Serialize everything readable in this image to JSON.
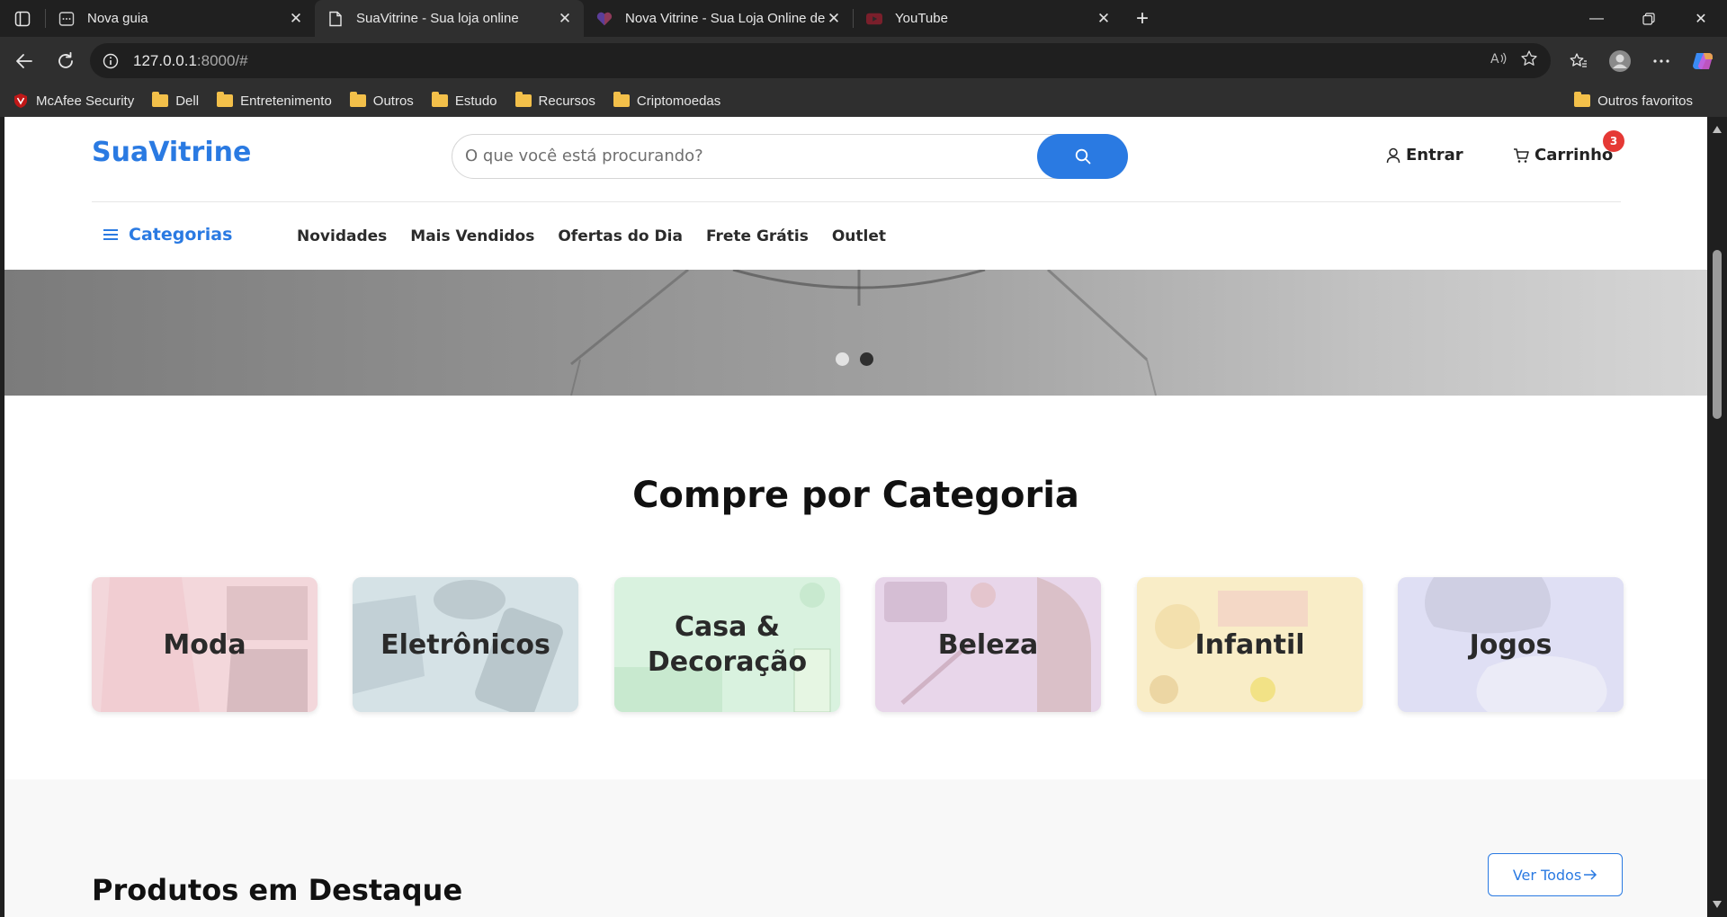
{
  "browser": {
    "tabs": [
      {
        "title": "Nova guia",
        "icon": "new-tab-page-icon",
        "active": false
      },
      {
        "title": "SuaVitrine - Sua loja online",
        "icon": "page-icon",
        "active": true
      },
      {
        "title": "Nova Vitrine - Sua Loja Online de",
        "icon": "heart-logo-icon",
        "active": false
      },
      {
        "title": "YouTube",
        "icon": "youtube-icon",
        "active": false
      }
    ],
    "url_host": "127.0.0.1",
    "url_rest": ":8000/#",
    "bookmarks": [
      "McAfee Security",
      "Dell",
      "Entretenimento",
      "Outros",
      "Estudo",
      "Recursos",
      "Criptomoedas"
    ],
    "other_favorites": "Outros favoritos"
  },
  "site": {
    "logo": "SuaVitrine",
    "search_placeholder": "O que você está procurando?",
    "login_label": "Entrar",
    "cart_label": "Carrinho",
    "cart_count": "3",
    "categories_toggle": "Categorias",
    "nav": [
      "Novidades",
      "Mais Vendidos",
      "Ofertas do Dia",
      "Frete Grátis",
      "Outlet"
    ],
    "hero_slides": 2,
    "hero_active_slide": 2,
    "shop_by_category_title": "Compre por Categoria",
    "category_cards": [
      {
        "label": "Moda",
        "tint": "#f6dde0"
      },
      {
        "label": "Eletrônicos",
        "tint": "#d7e4e8"
      },
      {
        "label": "Casa & Decoração",
        "tint": "#dcf3e1"
      },
      {
        "label": "Beleza",
        "tint": "#ead9ec"
      },
      {
        "label": "Infantil",
        "tint": "#faefc9"
      },
      {
        "label": "Jogos",
        "tint": "#e2e2f6"
      }
    ],
    "featured_title": "Produtos em Destaque",
    "see_all_label": "Ver Todos",
    "accent_color": "#2a7ae2",
    "badge_color": "#e53935"
  }
}
